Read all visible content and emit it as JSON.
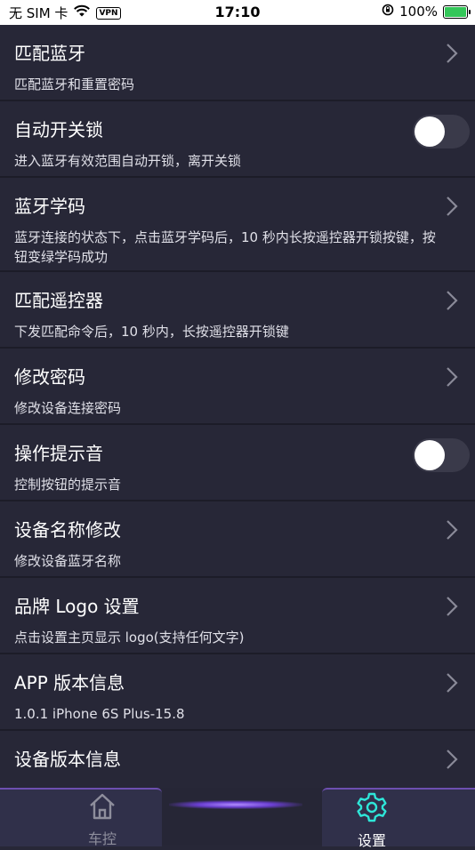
{
  "status_bar": {
    "carrier": "无 SIM 卡",
    "vpn": "VPN",
    "time": "17:10",
    "battery": "100%"
  },
  "settings": [
    {
      "title": "匹配蓝牙",
      "subtitle": "匹配蓝牙和重置密码",
      "control": "chevron"
    },
    {
      "title": "自动开关锁",
      "subtitle": "进入蓝牙有效范围自动开锁，离开关锁",
      "control": "toggle",
      "on": false
    },
    {
      "title": "蓝牙学码",
      "subtitle": "蓝牙连接的状态下，点击蓝牙学码后，10 秒内长按遥控器开锁按键，按钮变绿学码成功",
      "control": "chevron"
    },
    {
      "title": "匹配遥控器",
      "subtitle": "下发匹配命令后，10 秒内，长按遥控器开锁键",
      "control": "chevron"
    },
    {
      "title": "修改密码",
      "subtitle": "修改设备连接密码",
      "control": "chevron"
    },
    {
      "title": "操作提示音",
      "subtitle": "控制按钮的提示音",
      "control": "toggle",
      "on": false
    },
    {
      "title": "设备名称修改",
      "subtitle": "修改设备蓝牙名称",
      "control": "chevron"
    },
    {
      "title": "品牌 Logo 设置",
      "subtitle": "点击设置主页显示 logo(支持任何文字)",
      "control": "chevron"
    },
    {
      "title": "APP 版本信息",
      "subtitle": "1.0.1  iPhone 6S Plus-15.8",
      "control": "chevron"
    },
    {
      "title": "设备版本信息",
      "subtitle": "",
      "control": "chevron"
    }
  ],
  "tabbar": {
    "tabs": [
      {
        "label": "车控",
        "icon": "home-icon"
      },
      {
        "label": "设置",
        "icon": "gear-icon",
        "active": true
      }
    ],
    "active_color": "#2ee6d8"
  }
}
